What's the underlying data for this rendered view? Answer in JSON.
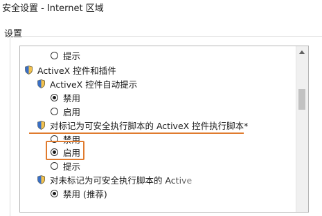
{
  "window": {
    "title": "安全设置 - Internet 区域"
  },
  "group": {
    "label": "设置"
  },
  "settings": {
    "row0": {
      "label": "提示",
      "checked": false
    },
    "row1": {
      "label": "ActiveX 控件和插件"
    },
    "row2": {
      "label": "ActiveX 控件自动提示"
    },
    "row3": {
      "label": "禁用",
      "checked": true
    },
    "row4": {
      "label": "启用",
      "checked": false
    },
    "row5": {
      "label": "对标记为可安全执行脚本的 ActiveX 控件执行脚本*"
    },
    "row6": {
      "label": "禁用",
      "checked": false
    },
    "row7": {
      "label": "启用",
      "checked": true
    },
    "row8": {
      "label": "提示",
      "checked": false
    },
    "row9": {
      "label": "对未标记为可安全执行脚本的 Active"
    },
    "row10": {
      "label": "禁用 (推荐)",
      "checked": true
    }
  },
  "colors": {
    "highlight": "#e07b2e"
  },
  "icons": {
    "setting": "shield-icon",
    "option": "radio-button"
  }
}
